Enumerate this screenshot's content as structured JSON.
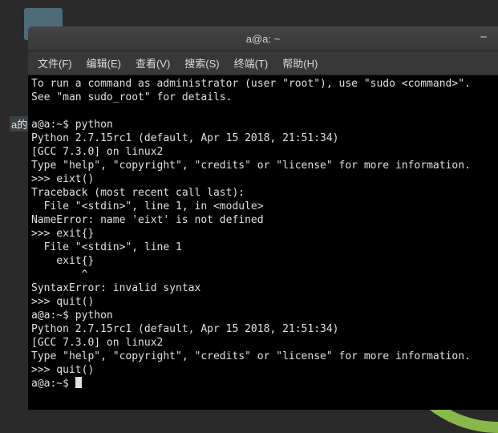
{
  "desktop": {
    "partial_label": "a的"
  },
  "window": {
    "title": "a@a: ~",
    "minimize_symbol": "−"
  },
  "menubar": {
    "items": [
      {
        "label": "文件(F)"
      },
      {
        "label": "编辑(E)"
      },
      {
        "label": "查看(V)"
      },
      {
        "label": "搜索(S)"
      },
      {
        "label": "终端(T)"
      },
      {
        "label": "帮助(H)"
      }
    ]
  },
  "terminal": {
    "lines": [
      "To run a command as administrator (user \"root\"), use \"sudo <command>\".",
      "See \"man sudo_root\" for details.",
      "",
      "a@a:~$ python",
      "Python 2.7.15rc1 (default, Apr 15 2018, 21:51:34) ",
      "[GCC 7.3.0] on linux2",
      "Type \"help\", \"copyright\", \"credits\" or \"license\" for more information.",
      ">>> eixt()",
      "Traceback (most recent call last):",
      "  File \"<stdin>\", line 1, in <module>",
      "NameError: name 'eixt' is not defined",
      ">>> exit{}",
      "  File \"<stdin>\", line 1",
      "    exit{}",
      "        ^",
      "SyntaxError: invalid syntax",
      ">>> quit()",
      "a@a:~$ python",
      "Python 2.7.15rc1 (default, Apr 15 2018, 21:51:34) ",
      "[GCC 7.3.0] on linux2",
      "Type \"help\", \"copyright\", \"credits\" or \"license\" for more information.",
      ">>> quit()"
    ],
    "current_prompt": "a@a:~$ "
  }
}
